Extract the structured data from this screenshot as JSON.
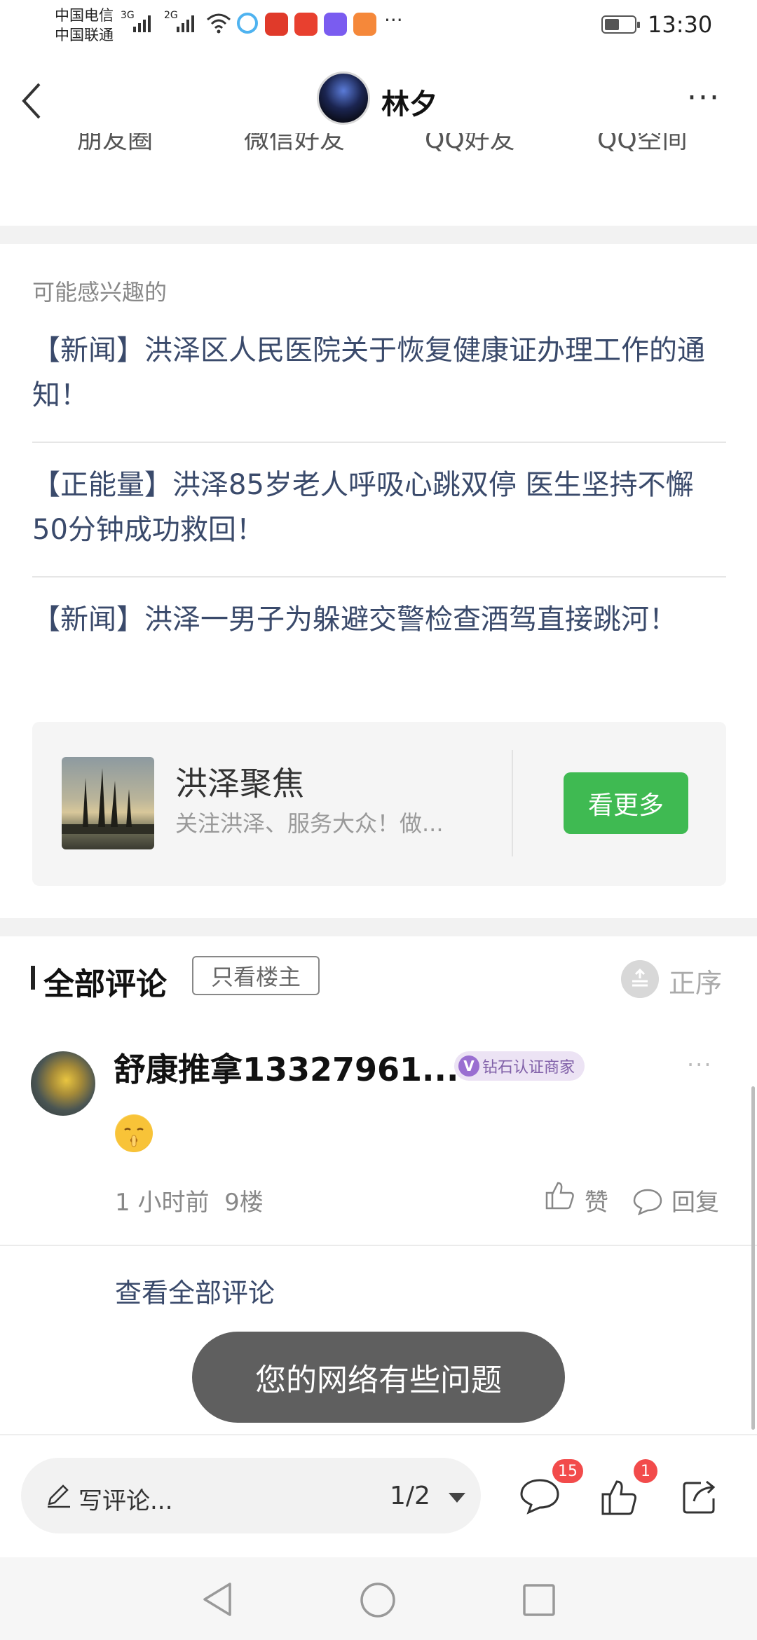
{
  "status_bar": {
    "carrier_1": "中国电信",
    "carrier_2": "中国联通",
    "net_1": "3G",
    "net_2": "2G",
    "time": "13:30",
    "overflow": "···",
    "app_icons": [
      "camera-app-icon",
      "game-app-icon",
      "video-app-icon",
      "player-app-icon"
    ]
  },
  "header": {
    "title": "林夕",
    "more": "···"
  },
  "interest": {
    "label": "可能感兴趣的",
    "items": [
      "【新闻】洪泽区人民医院关于恢复健康证办理工作的通知！",
      "【正能量】洪泽85岁老人呼吸心跳双停 医生坚持不懈50分钟成功救回！",
      "【新闻】洪泽一男子为躲避交警检查酒驾直接跳河！"
    ]
  },
  "account_card": {
    "name": "洪泽聚焦",
    "desc": "关注洪泽、服务大众！做...",
    "button": "看更多"
  },
  "comments": {
    "title": "全部评论",
    "owner_only": "只看楼主",
    "sort": "正序",
    "item": {
      "author": "舒康推拿13327961...",
      "badge_letter": "V",
      "badge": "钻石认证商家",
      "time": "1 小时前",
      "floor": "9楼",
      "like": "赞",
      "reply": "回复",
      "more": "···"
    },
    "view_all": "查看全部评论"
  },
  "toast": "您的网络有些问题",
  "bottom_bar": {
    "placeholder": "写评论...",
    "page": "1/2",
    "comment_count": "15",
    "like_count": "1"
  },
  "colors": {
    "accent_green": "#3fba52",
    "link_blue": "#3a4a6b",
    "badge_red": "#f24b4b"
  }
}
